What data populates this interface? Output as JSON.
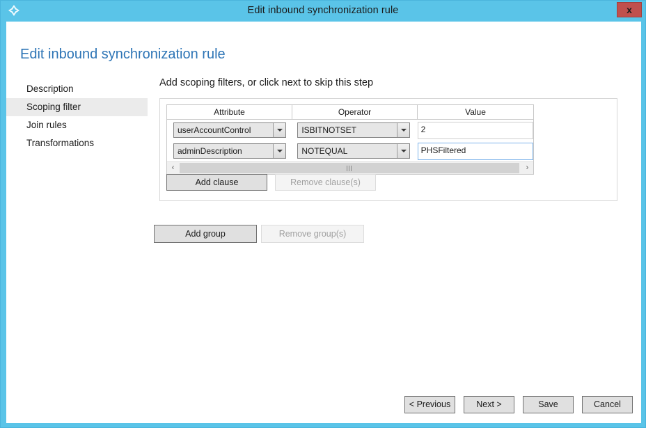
{
  "window": {
    "title": "Edit inbound synchronization rule",
    "app_icon": "azure-diamond-icon",
    "close_label": "x",
    "titlebar_color": "#5ac4e8"
  },
  "page": {
    "heading": "Edit inbound synchronization rule",
    "heading_color": "#2e75b6"
  },
  "sidebar": {
    "items": [
      {
        "label": "Description",
        "selected": false
      },
      {
        "label": "Scoping filter",
        "selected": true
      },
      {
        "label": "Join rules",
        "selected": false
      },
      {
        "label": "Transformations",
        "selected": false
      }
    ]
  },
  "main": {
    "heading": "Add scoping filters, or click next to skip this step",
    "table": {
      "columns": [
        "Attribute",
        "Operator",
        "Value"
      ],
      "rows": [
        {
          "attribute": "userAccountControl",
          "operator": "ISBITNOTSET",
          "value": "2",
          "value_focused": false
        },
        {
          "attribute": "adminDescription",
          "operator": "NOTEQUAL",
          "value": "PHSFiltered",
          "value_focused": true
        }
      ]
    },
    "scrollbar": {
      "left_arrow": "‹",
      "right_arrow": "›"
    },
    "clause_buttons": {
      "add": {
        "label": "Add clause",
        "enabled": true
      },
      "remove": {
        "label": "Remove clause(s)",
        "enabled": false
      }
    },
    "group_buttons": {
      "add": {
        "label": "Add group",
        "enabled": true
      },
      "remove": {
        "label": "Remove group(s)",
        "enabled": false
      }
    }
  },
  "footer": {
    "buttons": [
      {
        "label": "< Previous"
      },
      {
        "label": "Next >"
      },
      {
        "label": "Save"
      },
      {
        "label": "Cancel"
      }
    ]
  }
}
